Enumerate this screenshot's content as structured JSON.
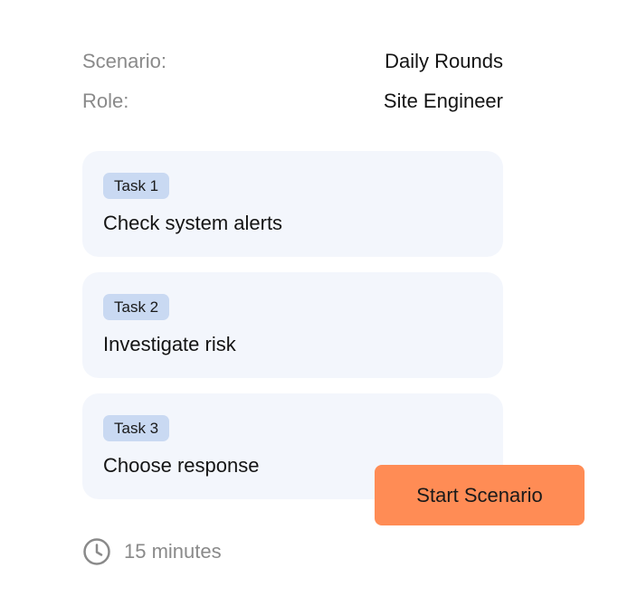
{
  "summary": {
    "scenario_label": "Scenario:",
    "scenario_value": "Daily Rounds",
    "role_label": "Role:",
    "role_value": "Site Engineer"
  },
  "tasks": [
    {
      "badge": "Task 1",
      "title": "Check system alerts"
    },
    {
      "badge": "Task 2",
      "title": "Investigate risk"
    },
    {
      "badge": "Task 3",
      "title": "Choose response"
    }
  ],
  "actions": {
    "start_label": "Start Scenario"
  },
  "duration": {
    "text": "15 minutes",
    "icon": "clock-icon"
  },
  "colors": {
    "accent": "#ff8c55",
    "card_bg": "#f3f6fc",
    "badge_bg": "#c9d9f2",
    "muted_text": "#8a8a8a"
  }
}
